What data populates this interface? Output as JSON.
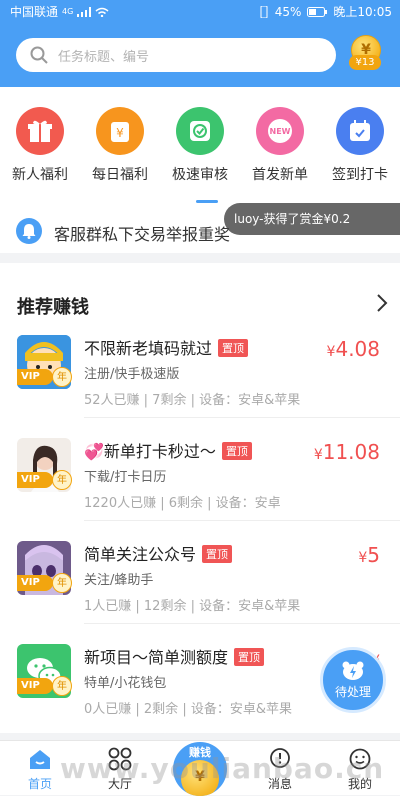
{
  "status": {
    "carrier": "中国联通",
    "network": "4G",
    "battery": "45%",
    "time": "晚上10:05"
  },
  "search": {
    "placeholder": "任务标题、编号",
    "icon": "search-icon"
  },
  "wallet": {
    "symbol": "¥",
    "amount": "¥13"
  },
  "categories": [
    {
      "label": "新人福利",
      "icon": "gift-icon",
      "color": "#f25a4f"
    },
    {
      "label": "每日福利",
      "icon": "money-bag-icon",
      "color": "#f7951e"
    },
    {
      "label": "极速审核",
      "icon": "check-icon",
      "color": "#3cc46e"
    },
    {
      "label": "首发新单",
      "icon": "new-badge-icon",
      "color": "#f36aa3"
    },
    {
      "label": "签到打卡",
      "icon": "calendar-icon",
      "color": "#4a7ff0"
    }
  ],
  "notice": {
    "text": "客服群私下交易举报重奖",
    "toast": "luoy-获得了赏金¥0.2"
  },
  "recommend": {
    "title": "推荐赚钱",
    "items": [
      {
        "title": "不限新老填码就过",
        "badge": "置顶",
        "sub": "注册/快手极速版",
        "meta": "52人已赚 | 7剩余 | 设备：安卓&苹果",
        "price_symbol": "¥",
        "price": "4.08",
        "vip": "VIP",
        "year": "年"
      },
      {
        "title": "💞新单打卡秒过～",
        "badge": "置顶",
        "sub": "下载/打卡日历",
        "meta": "1220人已赚 | 6剩余 | 设备：安卓",
        "price_symbol": "¥",
        "price": "11.08",
        "vip": "VIP",
        "year": "年"
      },
      {
        "title": "简单关注公众号",
        "badge": "置顶",
        "sub": "关注/蜂助手",
        "meta": "1人已赚 | 12剩余 | 设备：安卓&苹果",
        "price_symbol": "¥",
        "price": "5",
        "vip": "VIP",
        "year": "年"
      },
      {
        "title": "新项目～简单测额度",
        "badge": "置顶",
        "sub": "特单/小花钱包",
        "meta": "0人已赚 | 2剩余 | 设备：安卓&苹果",
        "price_symbol": "¥",
        "price": "",
        "vip": "VIP",
        "year": "年"
      }
    ]
  },
  "pending": {
    "label": "待处理"
  },
  "tabs": [
    {
      "label": "首页",
      "icon": "home-icon"
    },
    {
      "label": "大厅",
      "icon": "grid-icon"
    },
    {
      "label": "",
      "icon": "coin-icon"
    },
    {
      "label": "消息",
      "icon": "message-icon"
    },
    {
      "label": "我的",
      "icon": "profile-icon"
    }
  ],
  "watermark": "www.youlianbao.cn",
  "center_fab": {
    "caption": "赚钱",
    "symbol": "¥"
  }
}
